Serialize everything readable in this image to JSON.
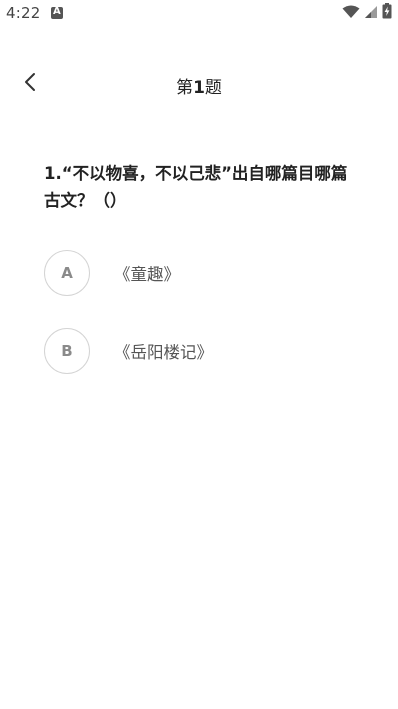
{
  "status_bar": {
    "time": "4:22",
    "icons": [
      "notification-a-icon",
      "wifi-icon",
      "signal-icon",
      "battery-charging-icon"
    ]
  },
  "header": {
    "title_prefix": "第",
    "title_number": "1",
    "title_suffix": "题",
    "back_icon": "chevron-left-icon"
  },
  "question": {
    "text": "1.“不以物喜，不以己悲”出自哪篇目哪篇古文？（）"
  },
  "options": [
    {
      "letter": "A",
      "text": "《童趣》"
    },
    {
      "letter": "B",
      "text": "《岳阳楼记》"
    }
  ],
  "colors": {
    "background": "#ffffff",
    "text_primary": "#222222",
    "option_text": "#555555",
    "option_border": "#d4d4d4",
    "option_letter": "#8a8a8a"
  }
}
